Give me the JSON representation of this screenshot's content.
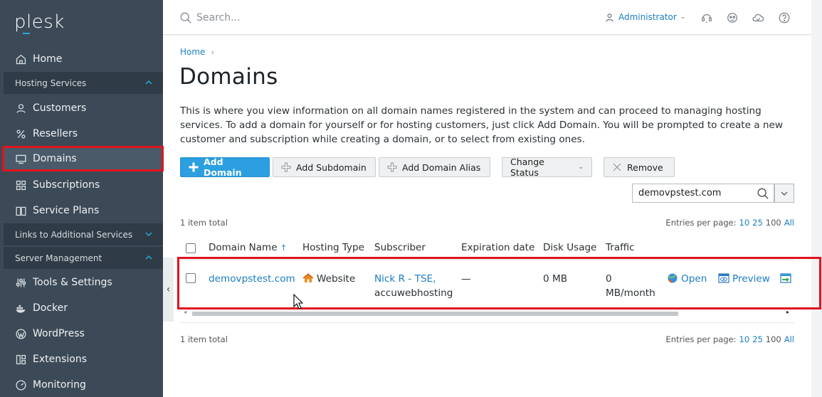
{
  "sidebar": {
    "logo": "plesk",
    "items_top": [
      {
        "label": "Home",
        "icon": "home-icon"
      }
    ],
    "hosting_services": {
      "label": "Hosting Services",
      "items": [
        {
          "label": "Customers",
          "icon": "user-icon"
        },
        {
          "label": "Resellers",
          "icon": "percent-icon"
        },
        {
          "label": "Domains",
          "icon": "monitor-icon"
        },
        {
          "label": "Subscriptions",
          "icon": "grid-icon"
        },
        {
          "label": "Service Plans",
          "icon": "book-icon"
        }
      ]
    },
    "links_additional": {
      "label": "Links to Additional Services"
    },
    "server_management": {
      "label": "Server Management",
      "items": [
        {
          "label": "Tools & Settings",
          "icon": "sliders-icon"
        },
        {
          "label": "Docker",
          "icon": "docker-icon"
        },
        {
          "label": "WordPress",
          "icon": "wordpress-icon"
        },
        {
          "label": "Extensions",
          "icon": "extensions-icon"
        },
        {
          "label": "Monitoring",
          "icon": "monitoring-icon"
        }
      ]
    }
  },
  "header": {
    "search_placeholder": "Search...",
    "user": "Administrator"
  },
  "breadcrumb": {
    "home": "Home"
  },
  "page": {
    "title": "Domains",
    "intro": "This is where you view information on all domain names registered in the system and can proceed to managing hosting services. To add a domain for yourself or for hosting customers, just click Add Domain. You will be prompted to create a new customer and subscription while creating a domain, or to select from existing ones."
  },
  "toolbar": {
    "add_domain": "Add Domain",
    "add_subdomain": "Add Subdomain",
    "add_domain_alias": "Add Domain Alias",
    "change_status": "Change Status",
    "remove": "Remove"
  },
  "filter": {
    "value": "demovpstest.com"
  },
  "list": {
    "items_total": "1 item total",
    "entries_label": "Entries per page:",
    "entries_options": [
      "10",
      "25",
      "100",
      "All"
    ],
    "entries_current": "100",
    "columns": [
      "Domain Name",
      "Hosting Type",
      "Subscriber",
      "Expiration date",
      "Disk Usage",
      "Traffic"
    ],
    "sort_indicator": "↑",
    "rows": [
      {
        "domain": "demovpstest.com",
        "hosting_type": "Website",
        "subscriber_name": "Nick R - TSE,",
        "subscriber_company": "accuwebhosting",
        "expiration": "—",
        "disk_usage": "0 MB",
        "traffic_line1": "0",
        "traffic_line2": "MB/month",
        "action_open": "Open",
        "action_preview": "Preview"
      }
    ]
  },
  "colors": {
    "sidebar_bg": "#3c4a57",
    "accent": "#2c9fe0",
    "link": "#1a7ec2",
    "highlight": "#e0141e"
  }
}
